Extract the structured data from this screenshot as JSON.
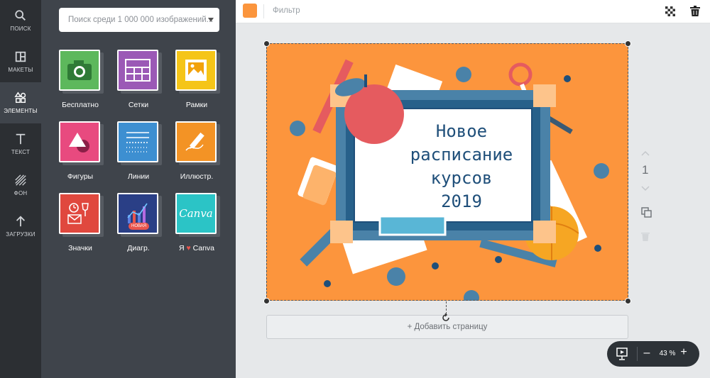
{
  "rail": [
    {
      "label": "ПОИСК",
      "icon": "search-icon"
    },
    {
      "label": "МАКЕТЫ",
      "icon": "layouts-icon"
    },
    {
      "label": "ЭЛЕМЕНТЫ",
      "icon": "elements-icon"
    },
    {
      "label": "ТЕКСТ",
      "icon": "text-icon"
    },
    {
      "label": "ФОН",
      "icon": "background-icon"
    },
    {
      "label": "ЗАГРУЗКИ",
      "icon": "upload-icon"
    }
  ],
  "panel": {
    "search_placeholder": "Поиск среди 1 000 000 изображений...",
    "tiles": [
      {
        "label": "Бесплатно",
        "color": "#5db85c",
        "icon": "camera-icon"
      },
      {
        "label": "Сетки",
        "color": "#9b59b6",
        "icon": "grid-icon"
      },
      {
        "label": "Рамки",
        "color": "#f5c518",
        "icon": "frame-icon"
      },
      {
        "label": "Фигуры",
        "color": "#e84a7f",
        "icon": "shapes-icon"
      },
      {
        "label": "Линии",
        "color": "#3d8fd1",
        "icon": "lines-icon"
      },
      {
        "label": "Иллюстр.",
        "color": "#f39325",
        "icon": "pencil-icon"
      },
      {
        "label": "Значки",
        "color": "#e0483e",
        "icon": "badges-icon"
      },
      {
        "label": "Диагр.",
        "color": "#2a3f86",
        "icon": "chart-icon",
        "badge": "НОВАЯ"
      },
      {
        "label_prefix": "Я",
        "label_heart": "♥",
        "label_suffix": "Canva",
        "color": "#2bc4c6",
        "icon": "canva-logo-icon",
        "logo_text": "Canva"
      }
    ]
  },
  "topbar": {
    "swatch_color": "#fb953d",
    "filter_label": "Фильтр"
  },
  "canvas": {
    "background": "#fc953d",
    "title_lines": [
      "Новое",
      "расписание",
      "курсов",
      "2019"
    ],
    "page_number": "1"
  },
  "add_page_label": "+ Добавить страницу",
  "zoom": {
    "value": "43 %",
    "minus": "–",
    "plus": "+"
  }
}
